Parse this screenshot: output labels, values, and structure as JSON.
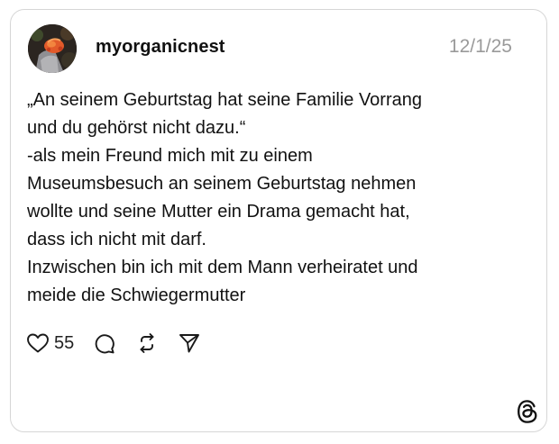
{
  "post": {
    "username": "myorganicnest",
    "date": "12/1/25",
    "lines": [
      "„An seinem Geburtstag hat seine Familie Vorrang",
      "und du gehörst nicht dazu.“",
      "-als mein Freund mich mit zu einem",
      "Museumsbesuch an seinem Geburtstag nehmen",
      "wollte und seine Mutter ein Drama gemacht hat,",
      "dass ich nicht mit darf.",
      "Inzwischen bin ich mit dem Mann verheiratet und",
      "meide die Schwiegermutter"
    ],
    "like_count": "55"
  },
  "icons": {
    "like": "heart-icon",
    "comment": "comment-bubble-icon",
    "repost": "repost-icon",
    "share": "send-icon",
    "brand": "threads-logo-icon"
  },
  "colors": {
    "text": "#111111",
    "date": "#9a9a9a",
    "border": "#d6d6d6",
    "background": "#ffffff"
  }
}
